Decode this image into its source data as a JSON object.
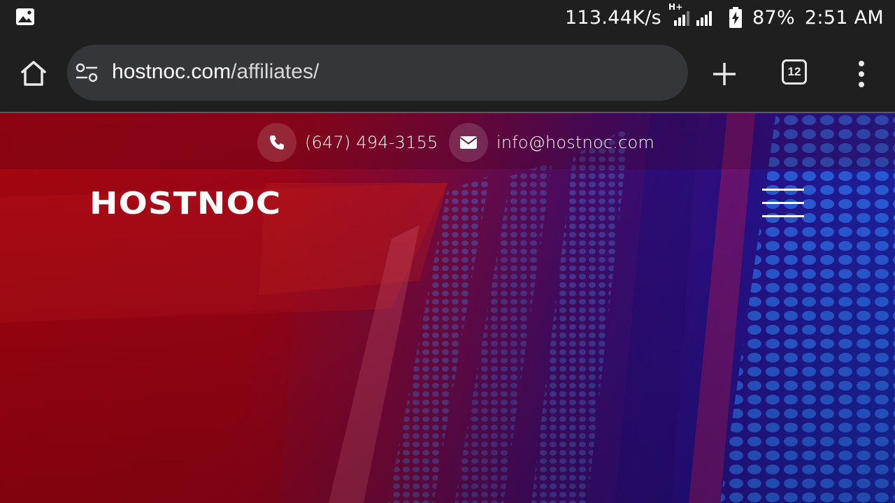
{
  "status_bar": {
    "speed": "113.44K/s",
    "network_type": "H+",
    "battery": "87%",
    "time": "2:51 AM",
    "icons": [
      "image-notification-icon",
      "signal-icon",
      "battery-charging-icon"
    ]
  },
  "browser": {
    "url_domain": "hostnoc.com",
    "url_path": "/affiliates/",
    "tab_count": "12",
    "icons": [
      "home-icon",
      "site-settings-icon",
      "plus-icon",
      "tab-switcher-icon",
      "more-vert-icon"
    ]
  },
  "page": {
    "contact": {
      "phone": "(647) 494-3155",
      "email": "info@hostnoc.com"
    },
    "logo_text": "HOSTNOC",
    "colors": {
      "red": "#b00610",
      "purple": "#4a0c6e",
      "blue": "#1a2ab0",
      "chrome_bg": "#1f1f1f",
      "url_bar_bg": "#34363a"
    }
  }
}
